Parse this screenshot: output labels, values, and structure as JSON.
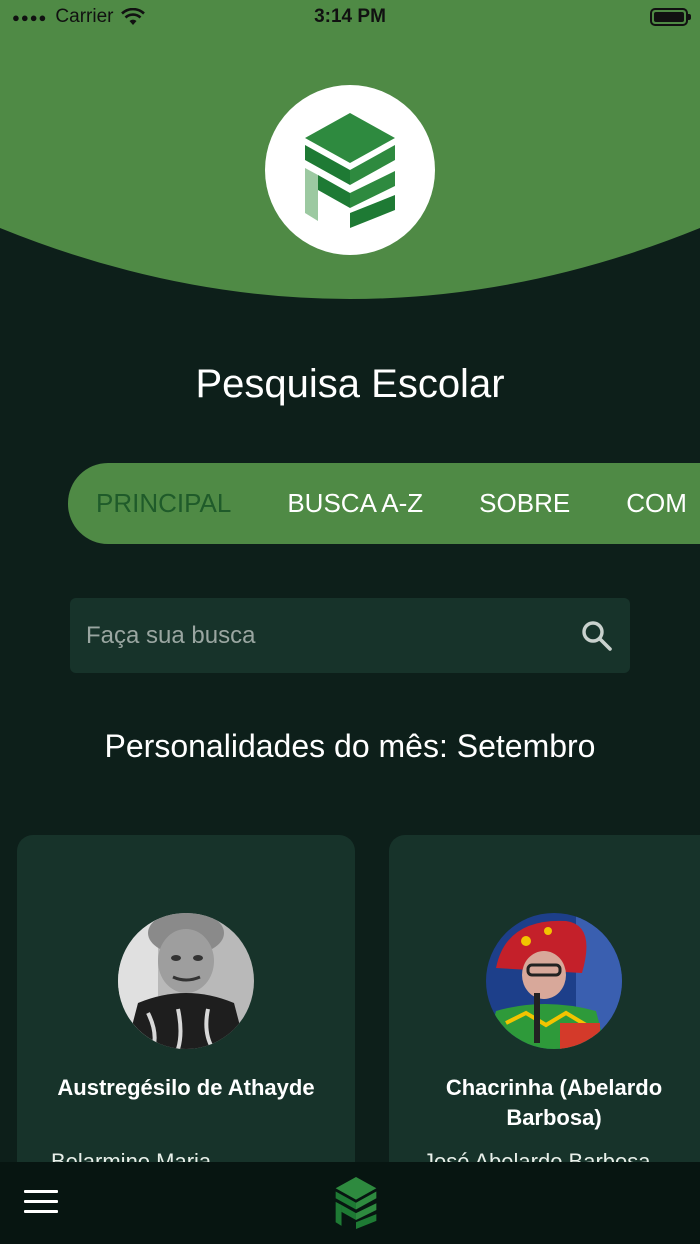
{
  "status_bar": {
    "carrier": "Carrier",
    "time": "3:14 PM"
  },
  "app": {
    "title": "Pesquisa Escolar"
  },
  "tabs": [
    {
      "label": "PRINCIPAL",
      "active": true
    },
    {
      "label": "BUSCA A-Z",
      "active": false
    },
    {
      "label": "SOBRE",
      "active": false
    },
    {
      "label": "COM",
      "active": false
    }
  ],
  "search": {
    "placeholder": "Faça sua busca"
  },
  "section": {
    "title": "Personalidades do mês: Setembro"
  },
  "cards": [
    {
      "name": "Austregésilo de Athayde",
      "subtitle": "Belarmino Maria"
    },
    {
      "name": "Chacrinha (Abelardo Barbosa)",
      "subtitle": "José Abelardo Barbosa"
    }
  ],
  "colors": {
    "background": "#0d1f1a",
    "header_green": "#4f8a45",
    "card_bg": "#17332a",
    "logo_green": "#1e7a34",
    "active_tab_text": "#1f5b2a"
  }
}
